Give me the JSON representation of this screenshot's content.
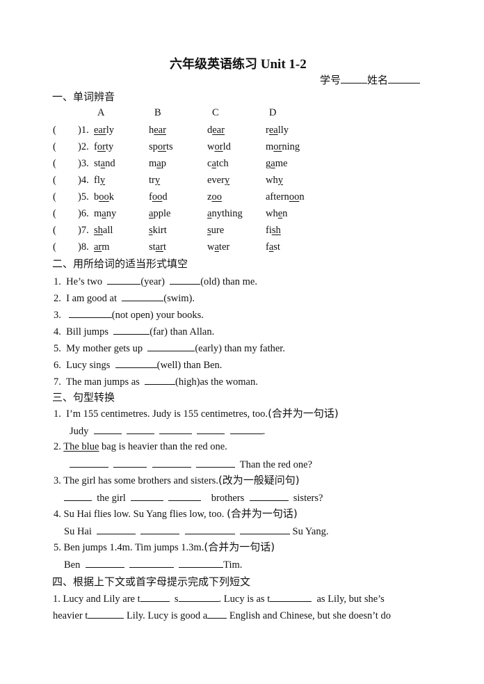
{
  "title": {
    "cn": "六年级英语练习",
    "en": "Unit 1-2"
  },
  "id_line": {
    "number_label": "学号",
    "name_label": "姓名"
  },
  "section1": {
    "heading": "一、单词辨音",
    "columns": [
      "A",
      "B",
      "C",
      "D"
    ],
    "rows": [
      {
        "num": ")1.",
        "words": [
          [
            "",
            "ear",
            "ly"
          ],
          [
            "h",
            "ear",
            ""
          ],
          [
            "d",
            "ear",
            ""
          ],
          [
            "r",
            "ea",
            "lly"
          ]
        ]
      },
      {
        "num": ")2.",
        "words": [
          [
            "f",
            "or",
            "ty"
          ],
          [
            "sp",
            "or",
            "ts"
          ],
          [
            "w",
            "or",
            "ld"
          ],
          [
            "m",
            "or",
            "ning"
          ]
        ]
      },
      {
        "num": ")3.",
        "words": [
          [
            "st",
            "a",
            "nd"
          ],
          [
            "m",
            "a",
            "p"
          ],
          [
            "c",
            "a",
            "tch"
          ],
          [
            "g",
            "a",
            "me"
          ]
        ]
      },
      {
        "num": ")4.",
        "words": [
          [
            "fl",
            "y",
            ""
          ],
          [
            "tr",
            "y",
            ""
          ],
          [
            "ever",
            "y",
            ""
          ],
          [
            "wh",
            "y",
            ""
          ]
        ]
      },
      {
        "num": ")5.",
        "words": [
          [
            "b",
            "oo",
            "k"
          ],
          [
            "f",
            "oo",
            "d"
          ],
          [
            "z",
            "oo",
            ""
          ],
          [
            "aftern",
            "oo",
            "n"
          ]
        ]
      },
      {
        "num": ")6.",
        "words": [
          [
            "m",
            "a",
            "ny"
          ],
          [
            "",
            "a",
            "pple"
          ],
          [
            "",
            "a",
            "nything"
          ],
          [
            "wh",
            "e",
            "n"
          ]
        ]
      },
      {
        "num": ")7.",
        "words": [
          [
            "",
            "sh",
            "all"
          ],
          [
            "",
            "s",
            "kirt"
          ],
          [
            "",
            "s",
            "ure"
          ],
          [
            "fi",
            "sh",
            ""
          ]
        ]
      },
      {
        "num": ")8.",
        "words": [
          [
            "",
            "ar",
            "m"
          ],
          [
            "st",
            "ar",
            "t"
          ],
          [
            "w",
            "a",
            "ter"
          ],
          [
            "f",
            "a",
            "st"
          ]
        ]
      }
    ]
  },
  "section2": {
    "heading": "二、用所给词的适当形式填空",
    "items": [
      {
        "num": "1.",
        "a": "He’s two ",
        "b": "(year) ",
        "c": "(old) than me."
      },
      {
        "num": "2.",
        "a": "I am good at ",
        "b": "(swim)."
      },
      {
        "num": "3.",
        "a": "",
        "b": "(not open) your books."
      },
      {
        "num": "4.",
        "a": "Bill jumps ",
        "b": "(far) than Allan."
      },
      {
        "num": "5.",
        "a": "My mother gets up ",
        "b": "(early) than my father."
      },
      {
        "num": "6.",
        "a": "Lucy sings ",
        "b": "(well) than Ben."
      },
      {
        "num": "7.",
        "a": "The man jumps as ",
        "b": "(high)as the woman."
      }
    ]
  },
  "section3": {
    "heading": "三、句型转换",
    "q1": {
      "num": "1.",
      "text": "I’m 155 centimetres. Judy is 155 centimetres, too.",
      "hint": "(合并为一句话)",
      "answer_start": "Judy",
      "answer_end": "."
    },
    "q2": {
      "num": "2.",
      "underlined": "The blue",
      "text": " bag is heavier than the red one.",
      "answer_end": "Than the red one?"
    },
    "q3": {
      "num": "3.",
      "text": "The girl has some brothers and sisters.",
      "hint": "(改为一般疑问句)",
      "w1": "the girl",
      "w2": "brothers",
      "w3": "sisters?"
    },
    "q4": {
      "num": "4.",
      "text": "Su Hai flies low. Su Yang flies low, too. ",
      "hint": "(合并为一句话)",
      "answer_start": "Su Hai",
      "answer_end": "Su Yang."
    },
    "q5": {
      "num": "5.",
      "text": "Ben jumps 1.4m. Tim jumps 1.3m.",
      "hint": "(合并为一句话)",
      "answer_start": "Ben",
      "answer_end": "Tim."
    }
  },
  "section4": {
    "heading": "四、根据上下文或首字母提示完成下列短文",
    "line1": {
      "p1": "1. Lucy and Lily are t",
      "p2": "s",
      "p3": ". Lucy is as t",
      "p4": " as Lily, but she’s"
    },
    "line2": {
      "p1": "heavier t",
      "p2": " Lily. Lucy is good a",
      "p3": " English and Chinese, but she doesn’t do"
    }
  }
}
